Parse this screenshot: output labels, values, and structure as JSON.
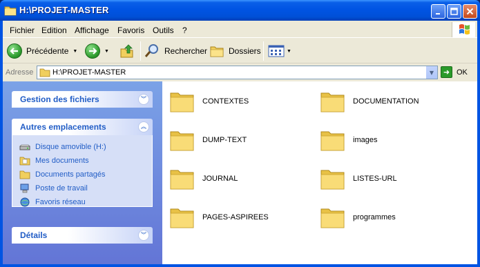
{
  "window": {
    "title": "H:\\PROJET-MASTER",
    "controls": [
      "minimize-icon",
      "maximize-icon",
      "close-icon"
    ]
  },
  "menu": {
    "items": [
      "Fichier",
      "Edition",
      "Affichage",
      "Favoris",
      "Outils",
      "?"
    ]
  },
  "toolbar": {
    "back_label": "Précédente",
    "search_label": "Rechercher",
    "folders_label": "Dossiers",
    "icons": [
      "back-arrow-icon",
      "forward-arrow-icon",
      "up-folder-icon",
      "search-magnifier-icon",
      "folders-icon",
      "views-icon"
    ]
  },
  "address": {
    "label": "Adresse",
    "value": "H:\\PROJET-MASTER",
    "go_label": "OK"
  },
  "tasks": {
    "file_management": {
      "title": "Gestion des fichiers"
    },
    "other_places": {
      "title": "Autres emplacements",
      "items": [
        {
          "label": "Disque amovible (H:)",
          "icon": "removable-drive-icon"
        },
        {
          "label": "Mes documents",
          "icon": "my-documents-icon"
        },
        {
          "label": "Documents partagés",
          "icon": "shared-folder-icon"
        },
        {
          "label": "Poste de travail",
          "icon": "my-computer-icon"
        },
        {
          "label": "Favoris réseau",
          "icon": "network-places-icon"
        }
      ]
    },
    "details": {
      "title": "Détails"
    }
  },
  "folders": [
    "CONTEXTES",
    "DOCUMENTATION",
    "DUMP-TEXT",
    "images",
    "JOURNAL",
    "LISTES-URL",
    "PAGES-ASPIREES",
    "programmes"
  ],
  "colors": {
    "titlebar": "#0054e3",
    "link_blue": "#215dc6",
    "taskpane": "#7ba2e7",
    "folder_yellow": "#f6d365"
  }
}
